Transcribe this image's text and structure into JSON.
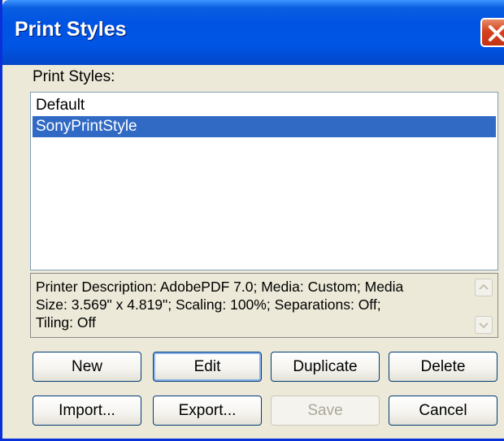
{
  "window": {
    "title": "Print Styles",
    "close_icon": "close-icon"
  },
  "list": {
    "label": "Print Styles:",
    "items": [
      "Default",
      "SonyPrintStyle"
    ],
    "selected": "SonyPrintStyle"
  },
  "description": {
    "line1": "Printer Description: AdobePDF 7.0;  Media: Custom;  Media",
    "line2": "Size: 3.569\" x 4.819\";  Scaling: 100%;  Separations: Off;",
    "line3": "Tiling: Off"
  },
  "buttons": {
    "new": "New",
    "edit": "Edit",
    "duplicate": "Duplicate",
    "delete": "Delete",
    "import": "Import...",
    "export": "Export...",
    "save": "Save",
    "cancel": "Cancel"
  },
  "colors": {
    "titlebar": "#0054e3",
    "selection": "#316ac5",
    "dialog_bg": "#ece9d8"
  }
}
